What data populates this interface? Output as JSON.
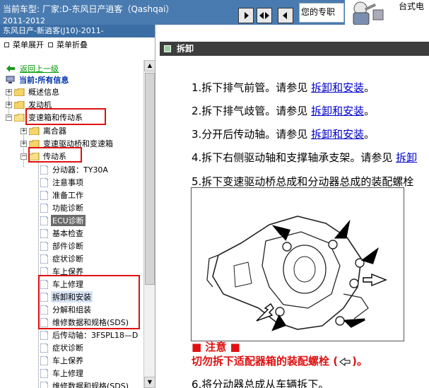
{
  "header": {
    "vehicle_info": "当前车型:  厂家:D-东风日产逍客（Qashqai）",
    "years": "2011-2012",
    "search_hint": "您的专职",
    "brand_label": "台式电"
  },
  "left": {
    "title": "东风日产-新逍客(J10)-2011-",
    "expand_menu": "菜单展开",
    "collapse_menu": "菜单折叠",
    "back_link": "返回上一级",
    "current_label": "当前:所有信息",
    "tree": [
      {
        "label": "概述信息"
      },
      {
        "label": "发动机"
      },
      {
        "label": "变速箱和传动系"
      },
      {
        "label": "离合器"
      },
      {
        "label": "变速驱动桥和变速箱"
      },
      {
        "label": "传动系"
      },
      {
        "label": "分动器：TY30A"
      },
      {
        "label": "注意事项"
      },
      {
        "label": "准备工作"
      },
      {
        "label": "功能诊断"
      },
      {
        "label": "ECU诊断"
      },
      {
        "label": "基本检查"
      },
      {
        "label": "部件诊断"
      },
      {
        "label": "症状诊断"
      },
      {
        "label": "车上保养"
      },
      {
        "label": "车上修理"
      },
      {
        "label": "拆卸和安装"
      },
      {
        "label": "分解和组装"
      },
      {
        "label": "维修数据和规格(SDS)"
      },
      {
        "label": "后传动轴：3FSPL18—D"
      },
      {
        "label": "症状诊断"
      },
      {
        "label": "车上保养"
      },
      {
        "label": "车上修理"
      },
      {
        "label": "维修数据和规格(SDS)"
      }
    ]
  },
  "content": {
    "section_title": "拆卸",
    "steps": [
      {
        "text": "1.拆下排气前管。请参见 ",
        "link": "拆卸和安装",
        "tail": "。"
      },
      {
        "text": "2.拆下排气歧管。请参见 ",
        "link": "拆卸和安装",
        "tail": "。"
      },
      {
        "text": "3.分开后传动轴。请参见 ",
        "link": "拆卸和安装",
        "tail": "。"
      },
      {
        "text": "4.拆下右侧驱动轴和支撑轴承支架。请参见 ",
        "link": "拆卸",
        "tail": ""
      },
      {
        "text": "5.拆下变速驱动桥总成和分动器总成的装配螺栓",
        "link": "",
        "tail": ""
      }
    ],
    "note_title": "■ 注意 ■",
    "note_text_before": "切勿拆下适配器箱的装配螺栓 (",
    "note_text_after": ")。",
    "step6": "6.将分动器总成从车辆拆下。"
  },
  "colors": {
    "header_bg": "#4a7bb0",
    "left_title_bg": "#3a6ea5",
    "section_bar_bg": "#3d3d3d",
    "link": "#0000cc",
    "tree_link": "#009900",
    "annotation_red": "#e01010",
    "selected_bg": "#6b6b6b"
  },
  "icons": {
    "prev": "triangle-left-icon",
    "page": "double-triangle-icon",
    "next": "triangle-right-icon",
    "back": "green-back-arrow-icon",
    "folder": "folder-icon",
    "doc": "document-icon"
  }
}
